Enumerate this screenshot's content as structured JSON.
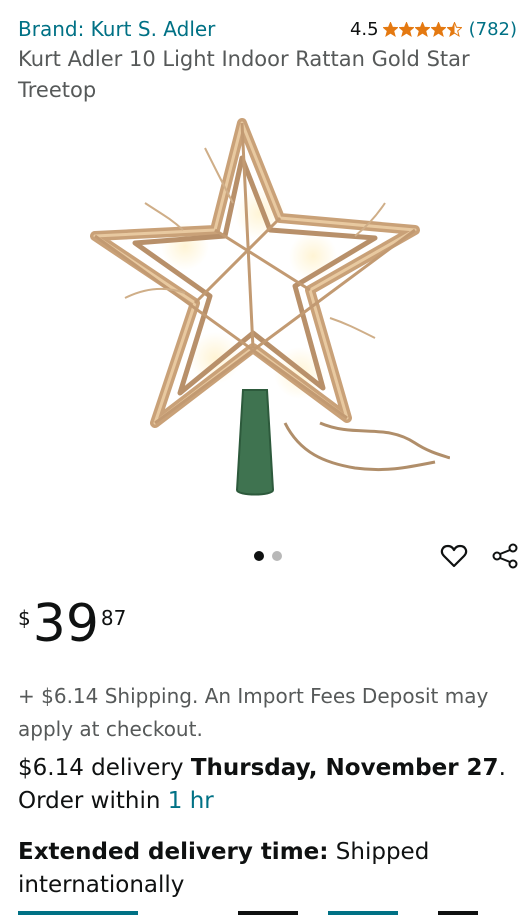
{
  "header": {
    "brand": "Brand: Kurt S. Adler",
    "rating_value": "4.5",
    "rating_stars": 4.5,
    "rating_count": "(782)"
  },
  "product": {
    "title": "Kurt Adler 10 Light Indoor Rattan Gold Star Treetop",
    "image_alt": "gold-rattan-star-treetop-image"
  },
  "gallery": {
    "current": 1,
    "total": 2
  },
  "price": {
    "symbol": "$",
    "whole": "39",
    "fraction": "87"
  },
  "shipping": {
    "note": "+ $6.14 Shipping. An Import Fees Deposit may apply at checkout."
  },
  "delivery": {
    "prefix": "$6.14 delivery ",
    "date": "Thursday, November 27",
    "suffix": ".",
    "order_prefix": "Order within ",
    "order_time": "1 hr"
  },
  "extended": {
    "label": "Extended delivery time:",
    "text": " Shipped internationally"
  },
  "colors": {
    "link": "#007185",
    "star": "#e47911",
    "text": "#0f1111",
    "muted": "#565959"
  }
}
